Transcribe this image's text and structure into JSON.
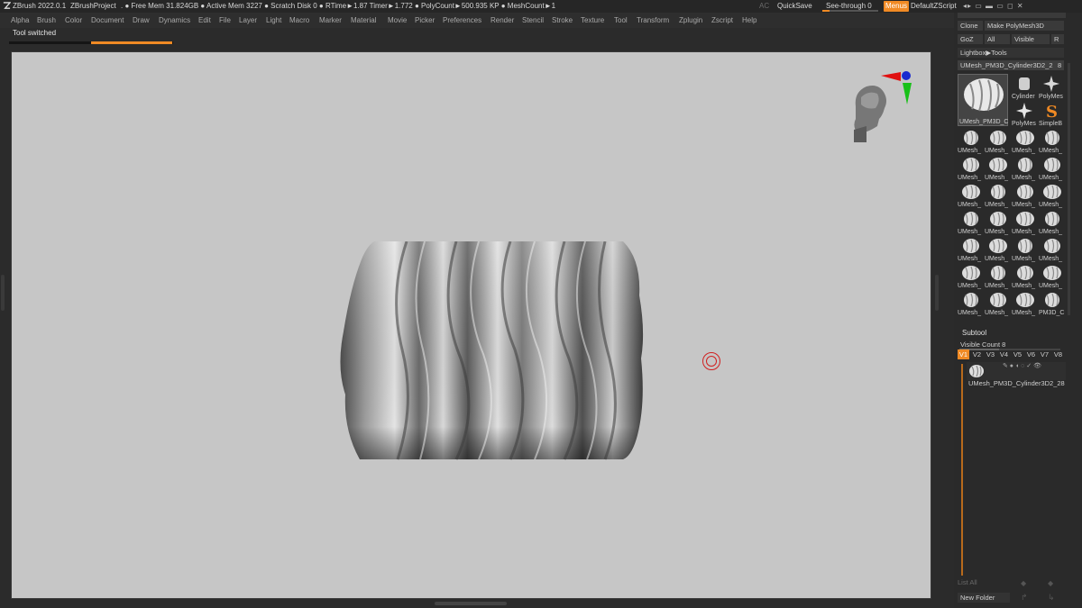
{
  "titlebar": {
    "app": "ZBrush 2022.0.1",
    "project": "ZBrushProject",
    "stats": ". ● Free Mem 31.824GB ● Active Mem 3227 ● Scratch Disk 0 ●  RTime►1.87 Timer►1.772 ● PolyCount►500.935 KP  ● MeshCount►1",
    "ac": "AC",
    "quicksave": "QuickSave",
    "seethrough": "See-through   0",
    "menus": "Menus",
    "script": "DefaultZScript"
  },
  "menubar": {
    "items": [
      "Alpha",
      "Brush",
      "Color",
      "Document",
      "Draw",
      "Dynamics",
      "Edit",
      "File",
      "Layer",
      "Light",
      "Macro",
      "Marker",
      "Material",
      "Movie",
      "Picker",
      "Preferences",
      "Render",
      "Stencil",
      "Stroke",
      "Texture",
      "Tool",
      "Transform",
      "Zplugin",
      "Zscript",
      "Help"
    ]
  },
  "notification": {
    "text": "Tool switched",
    "progress": 0.5
  },
  "tool_panel": {
    "clone": "Clone",
    "make_polymesh": "Make PolyMesh3D",
    "goz": "GoZ",
    "all": "All",
    "visible": "Visible",
    "r": "R",
    "lightbox_tools": "Lightbox▶Tools",
    "current_tool": "UMesh_PM3D_Cylinder3D2_2",
    "current_tool_num": "8",
    "big_thumb_label": "UMesh_PM3D_C",
    "side_thumbs": [
      "Cylinder",
      "PolyMes",
      "PolyMes",
      "SimpleB"
    ],
    "grid_label": "UMesh_",
    "grid_last": "PM3D_C"
  },
  "subtool": {
    "title": "Subtool",
    "visible_count": "Visible Count 8",
    "versions": [
      "V1",
      "V2",
      "V3",
      "V4",
      "V5",
      "V6",
      "V7",
      "V8"
    ],
    "active_version": "V1",
    "item_name": "UMesh_PM3D_Cylinder3D2_28",
    "list_all": "List All",
    "new_folder": "New Folder"
  },
  "colors": {
    "accent": "#f08a24",
    "canvas": "#c6c6c6",
    "panel": "#2a2a2a"
  }
}
